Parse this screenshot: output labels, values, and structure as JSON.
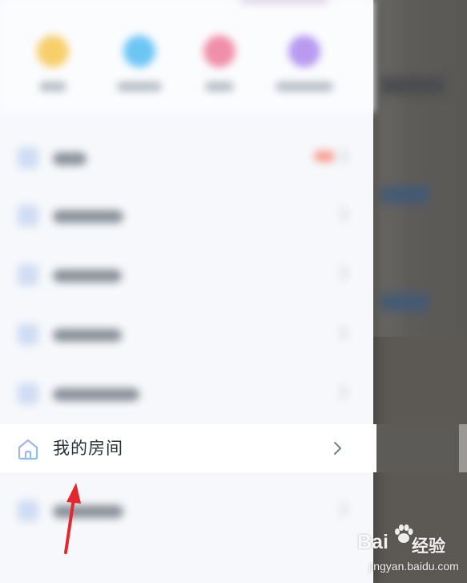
{
  "menu": {
    "my_room_label": "我的房间"
  },
  "icons": {
    "home": "home-icon",
    "chevron": "chevron-right-icon",
    "arrow": "red-arrow-annotation"
  },
  "colors": {
    "accent_blue": "#8fb4ef",
    "arrow_red": "#e2282e",
    "drawer_bg": "#f6f8fb",
    "label_text": "#2b2f36"
  },
  "watermark": {
    "brand_left": "Bai",
    "brand_right": "经验",
    "url": "jingyan.baidu.com"
  }
}
